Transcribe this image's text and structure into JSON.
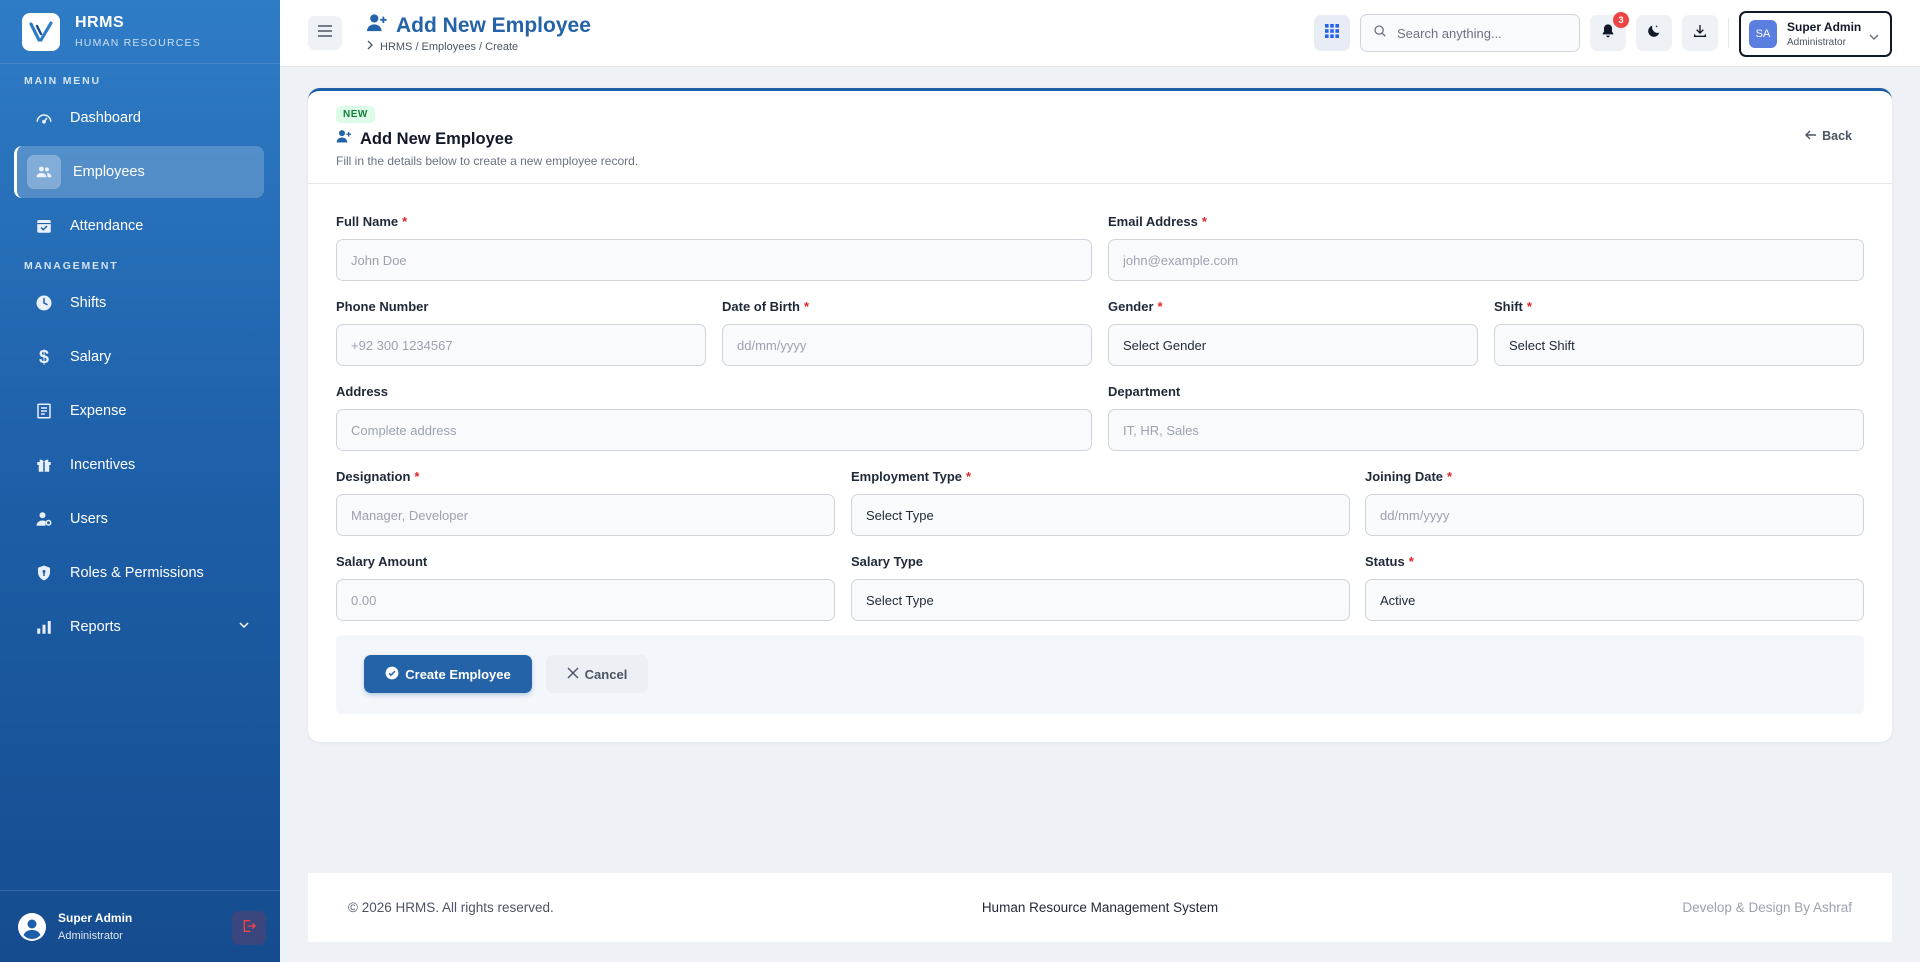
{
  "brand": {
    "name": "HRMS",
    "subtitle": "HUMAN RESOURCES"
  },
  "sidebar": {
    "main_menu_label": "MAIN MENU",
    "management_label": "MANAGEMENT",
    "items": [
      {
        "label": "Dashboard",
        "icon": "dashboard-icon"
      },
      {
        "label": "Employees",
        "icon": "users-icon",
        "active": true
      },
      {
        "label": "Attendance",
        "icon": "calendar-check-icon"
      },
      {
        "label": "Shifts",
        "icon": "clock-icon"
      },
      {
        "label": "Salary",
        "icon": "dollar-icon"
      },
      {
        "label": "Expense",
        "icon": "receipt-icon"
      },
      {
        "label": "Incentives",
        "icon": "gift-icon"
      },
      {
        "label": "Users",
        "icon": "user-cog-icon"
      },
      {
        "label": "Roles & Permissions",
        "icon": "shield-icon"
      },
      {
        "label": "Reports",
        "icon": "bar-chart-icon"
      }
    ],
    "footer_user": {
      "name": "Super Admin",
      "role": "Administrator"
    }
  },
  "header": {
    "title": "Add New Employee",
    "breadcrumb": "HRMS / Employees / Create",
    "search_placeholder": "Search anything...",
    "notification_count": "3",
    "user": {
      "initials": "SA",
      "name": "Super Admin",
      "role": "Administrator"
    }
  },
  "card": {
    "badge": "NEW",
    "title": "Add New Employee",
    "subtitle": "Fill in the details below to create a new employee record.",
    "back_label": "Back"
  },
  "form": {
    "full_name": {
      "label": "Full Name",
      "placeholder": "John Doe",
      "required": "*"
    },
    "email": {
      "label": "Email Address",
      "placeholder": "john@example.com",
      "required": "*"
    },
    "phone": {
      "label": "Phone Number",
      "placeholder": "+92 300 1234567"
    },
    "dob": {
      "label": "Date of Birth",
      "placeholder": "dd/mm/yyyy",
      "required": "*"
    },
    "gender": {
      "label": "Gender",
      "value": "Select Gender",
      "required": "*"
    },
    "shift": {
      "label": "Shift",
      "value": "Select Shift",
      "required": "*"
    },
    "address": {
      "label": "Address",
      "placeholder": "Complete address"
    },
    "department": {
      "label": "Department",
      "placeholder": "IT, HR, Sales"
    },
    "designation": {
      "label": "Designation",
      "placeholder": "Manager, Developer",
      "required": "*"
    },
    "employment_type": {
      "label": "Employment Type",
      "value": "Select Type",
      "required": "*"
    },
    "joining_date": {
      "label": "Joining Date",
      "placeholder": "dd/mm/yyyy",
      "required": "*"
    },
    "salary_amount": {
      "label": "Salary Amount",
      "placeholder": "0.00"
    },
    "salary_type": {
      "label": "Salary Type",
      "value": "Select Type"
    },
    "status": {
      "label": "Status",
      "value": "Active",
      "required": "*"
    }
  },
  "actions": {
    "create_label": "Create Employee",
    "cancel_label": "Cancel"
  },
  "footer": {
    "copyright": "© 2026 HRMS. All rights reserved.",
    "center": "Human Resource Management System",
    "credit": "Develop & Design By Ashraf"
  },
  "colors": {
    "primary": "#2563a8",
    "sidebar_top": "#2f7cc6",
    "sidebar_bottom": "#154c8f",
    "danger": "#dc2626",
    "success_bg": "#dcfce7"
  }
}
